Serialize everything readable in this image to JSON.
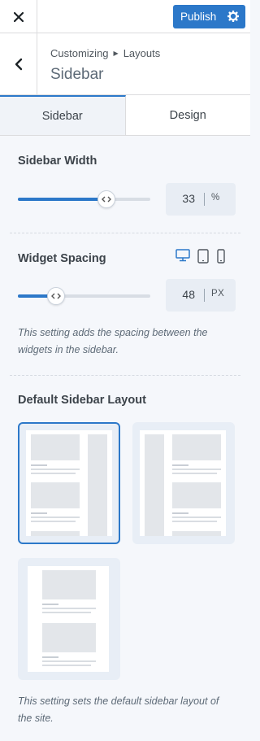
{
  "topbar": {
    "close_label": "Close",
    "publish_label": "Publish"
  },
  "header": {
    "breadcrumb": [
      "Customizing",
      "Layouts"
    ],
    "title": "Sidebar"
  },
  "tabs": [
    {
      "label": "Sidebar",
      "active": true
    },
    {
      "label": "Design",
      "active": false
    }
  ],
  "sidebar_width": {
    "label": "Sidebar Width",
    "value": "33",
    "unit": "%",
    "fraction": 0.67
  },
  "widget_spacing": {
    "label": "Widget Spacing",
    "value": "48",
    "unit": "PX",
    "fraction": 0.29,
    "devices": [
      "desktop-icon",
      "tablet-icon",
      "mobile-icon"
    ],
    "description": "This setting adds the spacing between the widgets in the sidebar."
  },
  "default_layout": {
    "label": "Default Sidebar Layout",
    "options": [
      "right-sidebar",
      "left-sidebar",
      "no-sidebar"
    ],
    "selected": "right-sidebar",
    "description": "This setting sets the default sidebar layout of the site."
  },
  "colors": {
    "accent": "#2c78c9",
    "card_bg": "#e8eef6"
  }
}
